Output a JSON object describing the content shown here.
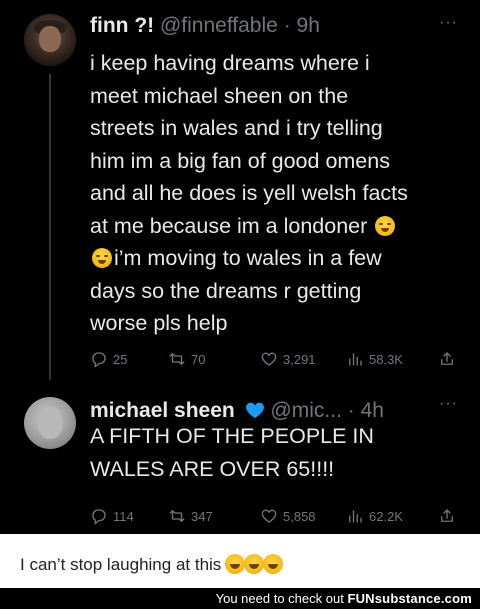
{
  "tweet1": {
    "display_name": "finn ?!",
    "handle": "@finneffable",
    "separator": "·",
    "time": "9h",
    "more": "···",
    "lines": [
      "i keep having dreams where i",
      "meet michael sheen on the",
      "streets in wales and i try telling",
      "him im a big fan of good omens",
      "and all he does is yell welsh facts",
      "at me because im a londoner",
      "i’m moving to wales in a few",
      "days so the dreams r getting",
      "worse pls help"
    ],
    "replies": "25",
    "retweets": "70",
    "likes": "3,291",
    "views": "58.3K"
  },
  "tweet2": {
    "display_name": "michael sheen",
    "handle": "@mic...",
    "separator": "·",
    "time": "4h",
    "more": "···",
    "lines": [
      "A FIFTH OF THE PEOPLE IN",
      "WALES ARE OVER 65!!!!"
    ],
    "replies": "114",
    "retweets": "347",
    "likes": "5,858",
    "views": "62.2K",
    "verified_color": "#1d9bf0",
    "heart_color": "#1d9bf0"
  },
  "caption": {
    "text": "I can’t stop laughing at this"
  },
  "footer": {
    "prefix": "You need to check out",
    "brand": "FUNsubstance.com"
  },
  "colors": {
    "background": "#000000",
    "text": "#e7e9ea",
    "muted": "#71767b",
    "verified": "#1d9bf0"
  }
}
